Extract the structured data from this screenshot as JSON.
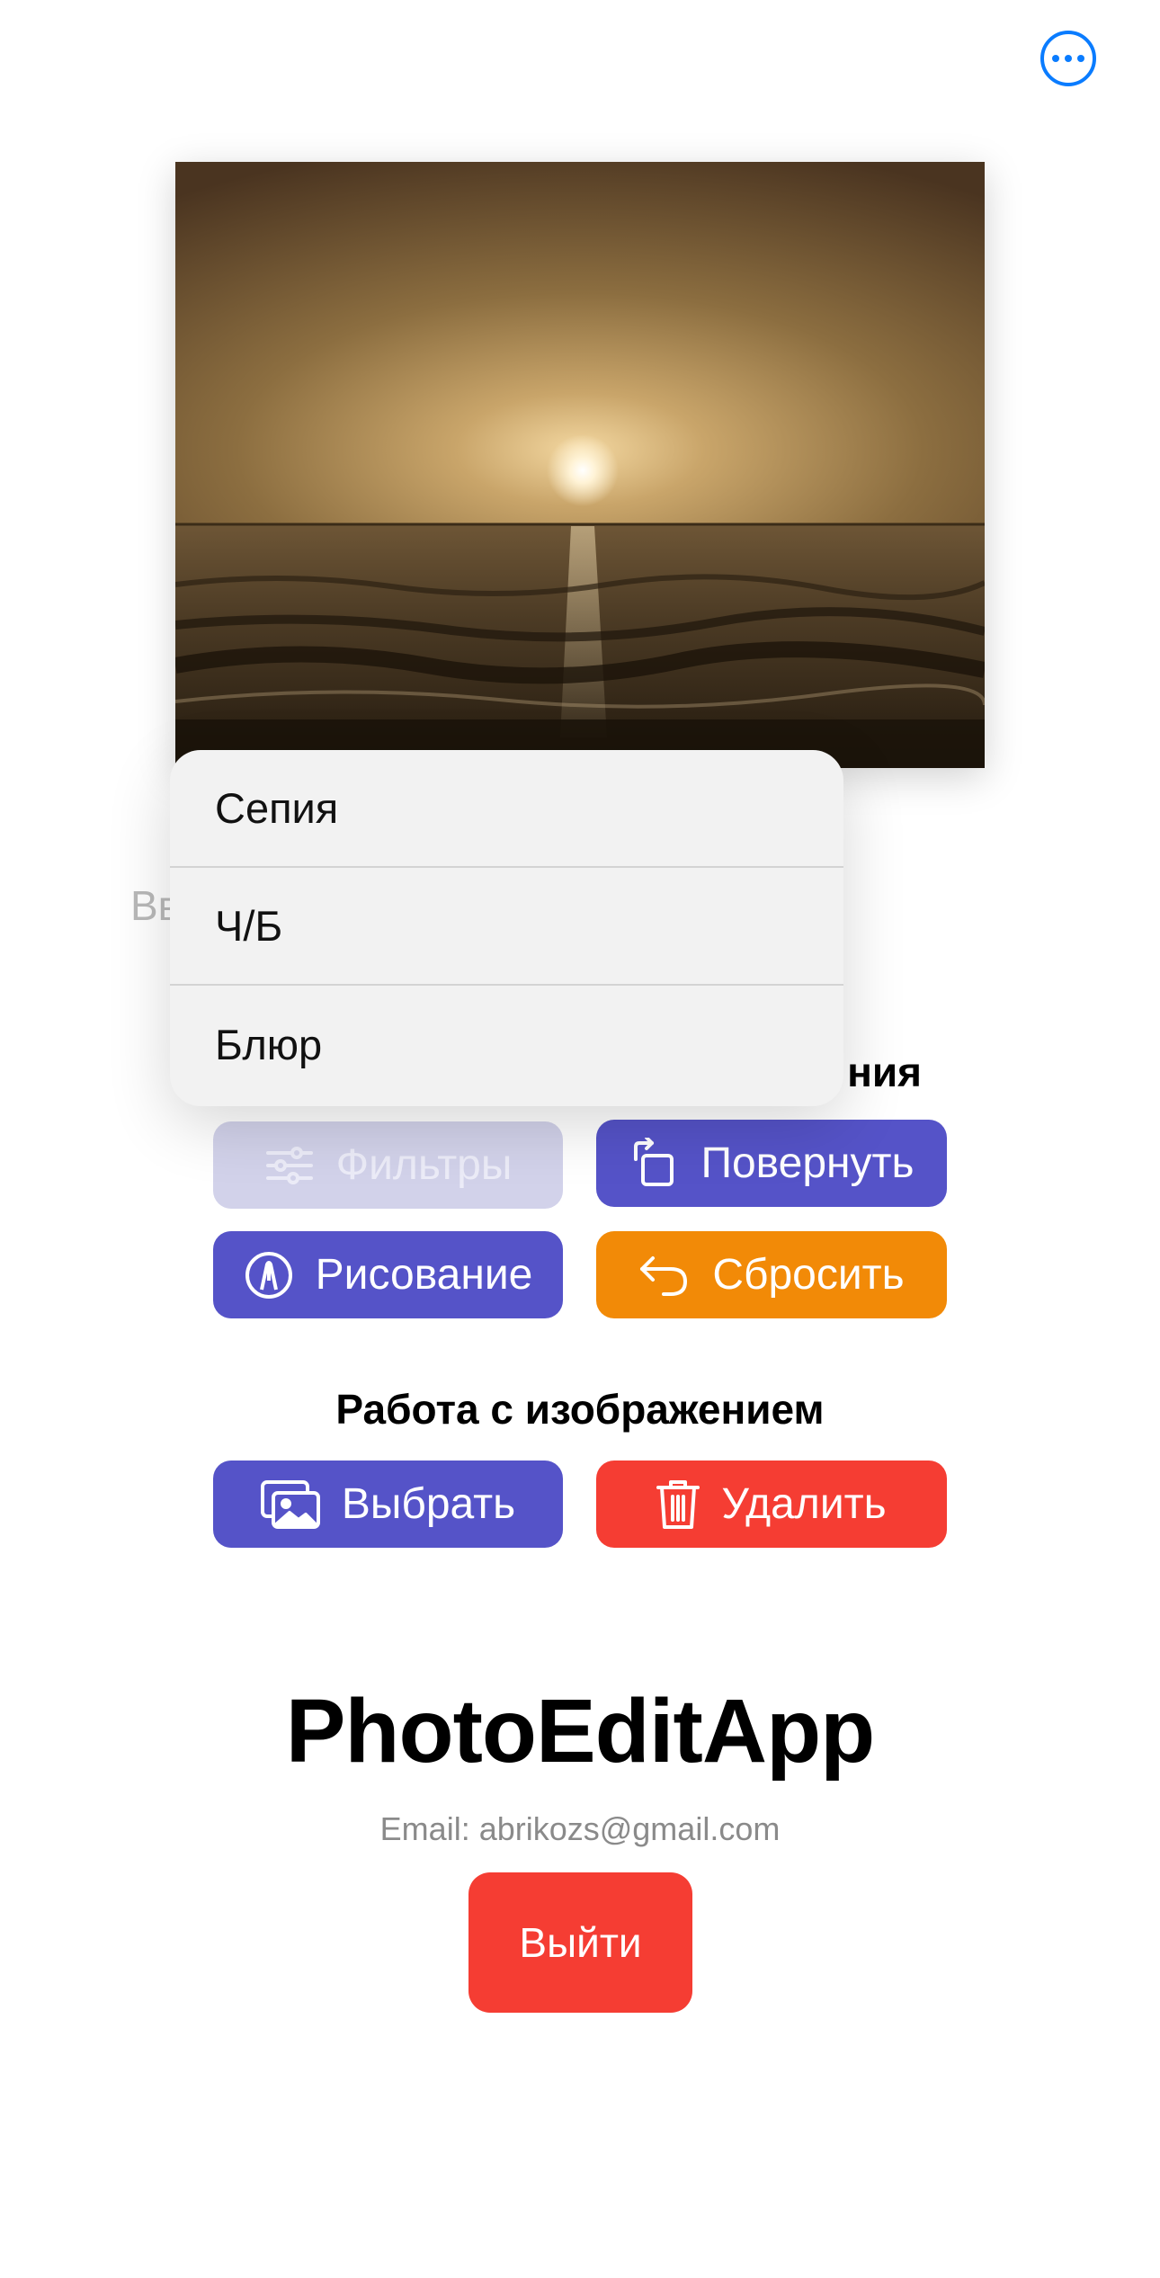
{
  "header": {
    "more_icon": "ellipsis-circle-icon",
    "accent": "#0a7cff"
  },
  "image": {
    "description_icon": "sunset-sea-photo"
  },
  "partially_hidden_label": "Вв",
  "section_edit_partial": "ния",
  "filter_menu": {
    "items": [
      {
        "label": "Сепия"
      },
      {
        "label": "Ч/Б"
      },
      {
        "label": "Блюр"
      }
    ]
  },
  "edit_buttons": {
    "filters": {
      "label": "Фильтры",
      "icon": "sliders-icon"
    },
    "rotate": {
      "label": "Повернуть",
      "icon": "rotate-icon"
    },
    "draw": {
      "label": "Рисование",
      "icon": "pen-circle-icon"
    },
    "reset": {
      "label": "Сбросить",
      "icon": "undo-arrow-icon"
    }
  },
  "image_section": {
    "title": "Работа с изображением",
    "choose": {
      "label": "Выбрать",
      "icon": "photos-icon"
    },
    "delete": {
      "label": "Удалить",
      "icon": "trash-icon"
    }
  },
  "app": {
    "name": "PhotoEditApp",
    "email": "Email: abrikozs@gmail.com",
    "logout_label": "Выйти"
  },
  "colors": {
    "indigo": "#5553c8",
    "orange": "#f28a07",
    "red": "#f53d33",
    "disabled": "#d2d2ea"
  }
}
